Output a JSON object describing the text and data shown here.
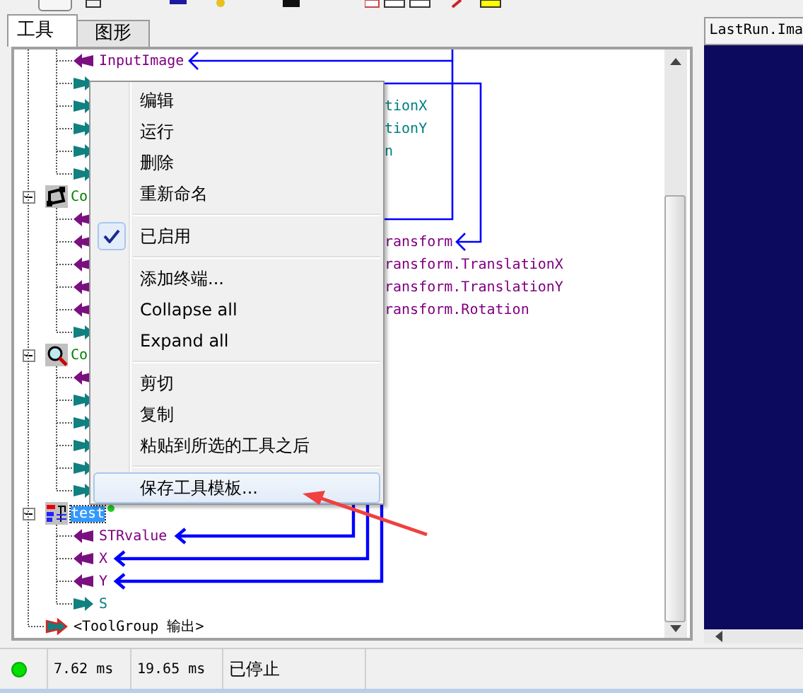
{
  "tabs": [
    {
      "label": "工具",
      "selected": true
    },
    {
      "label": "图形",
      "selected": false
    }
  ],
  "tree": {
    "clipped_node_terminals": [
      {
        "kind": "input",
        "label": "InputImage"
      },
      {
        "kind": "output"
      },
      {
        "kind": "output",
        "label": "tionX"
      },
      {
        "kind": "output",
        "label": "tionY"
      },
      {
        "kind": "output",
        "label": "n"
      },
      {
        "kind": "output"
      }
    ],
    "nodes": [
      {
        "kind": "affine",
        "label": "Co",
        "expanded": true,
        "selected": false,
        "children": [
          {
            "kind": "input"
          },
          {
            "kind": "input",
            "label": "ransform"
          },
          {
            "kind": "input",
            "label": "ransform.TranslationX"
          },
          {
            "kind": "input",
            "label": "ransform.TranslationY"
          },
          {
            "kind": "input",
            "label": "ransform.Rotation"
          },
          {
            "kind": "output"
          }
        ]
      },
      {
        "kind": "search",
        "label": "Co",
        "expanded": true,
        "selected": false,
        "children": [
          {
            "kind": "input"
          },
          {
            "kind": "output"
          },
          {
            "kind": "output"
          },
          {
            "kind": "output"
          },
          {
            "kind": "output"
          },
          {
            "kind": "output"
          }
        ]
      },
      {
        "kind": "script",
        "label": "test",
        "expanded": true,
        "selected": true,
        "status_dot": true,
        "children": [
          {
            "kind": "input",
            "label": "STRvalue"
          },
          {
            "kind": "input",
            "label": "X"
          },
          {
            "kind": "input",
            "label": "Y"
          },
          {
            "kind": "output",
            "label": "S"
          }
        ]
      }
    ],
    "output": "<ToolGroup 输出>"
  },
  "context_menu": [
    {
      "kind": "command",
      "label": "编辑",
      "checked": false,
      "selected": false
    },
    {
      "kind": "command",
      "label": "运行",
      "checked": false,
      "selected": false
    },
    {
      "kind": "command",
      "label": "删除",
      "checked": false,
      "selected": false
    },
    {
      "kind": "command",
      "label": "重新命名",
      "checked": false,
      "selected": false
    },
    {
      "kind": "separator"
    },
    {
      "kind": "command",
      "label": "已启用",
      "checked": true,
      "selected": false
    },
    {
      "kind": "separator"
    },
    {
      "kind": "command",
      "label": "添加终端...",
      "checked": false,
      "selected": false
    },
    {
      "kind": "command",
      "label": "Collapse all",
      "checked": false,
      "selected": false
    },
    {
      "kind": "command",
      "label": "Expand all",
      "checked": false,
      "selected": false
    },
    {
      "kind": "separator"
    },
    {
      "kind": "command",
      "label": "剪切",
      "checked": false,
      "selected": false
    },
    {
      "kind": "command",
      "label": "复制",
      "checked": false,
      "selected": false
    },
    {
      "kind": "command",
      "label": "粘贴到所选的工具之后",
      "checked": false,
      "selected": false
    },
    {
      "kind": "separator"
    },
    {
      "kind": "command",
      "label": "保存工具模板...",
      "checked": false,
      "selected": true
    }
  ],
  "image_panel": {
    "tab": "LastRun.Ima"
  },
  "status_bar": {
    "times": [
      "7.62 ms",
      "19.65 ms"
    ],
    "state": "已停止"
  }
}
